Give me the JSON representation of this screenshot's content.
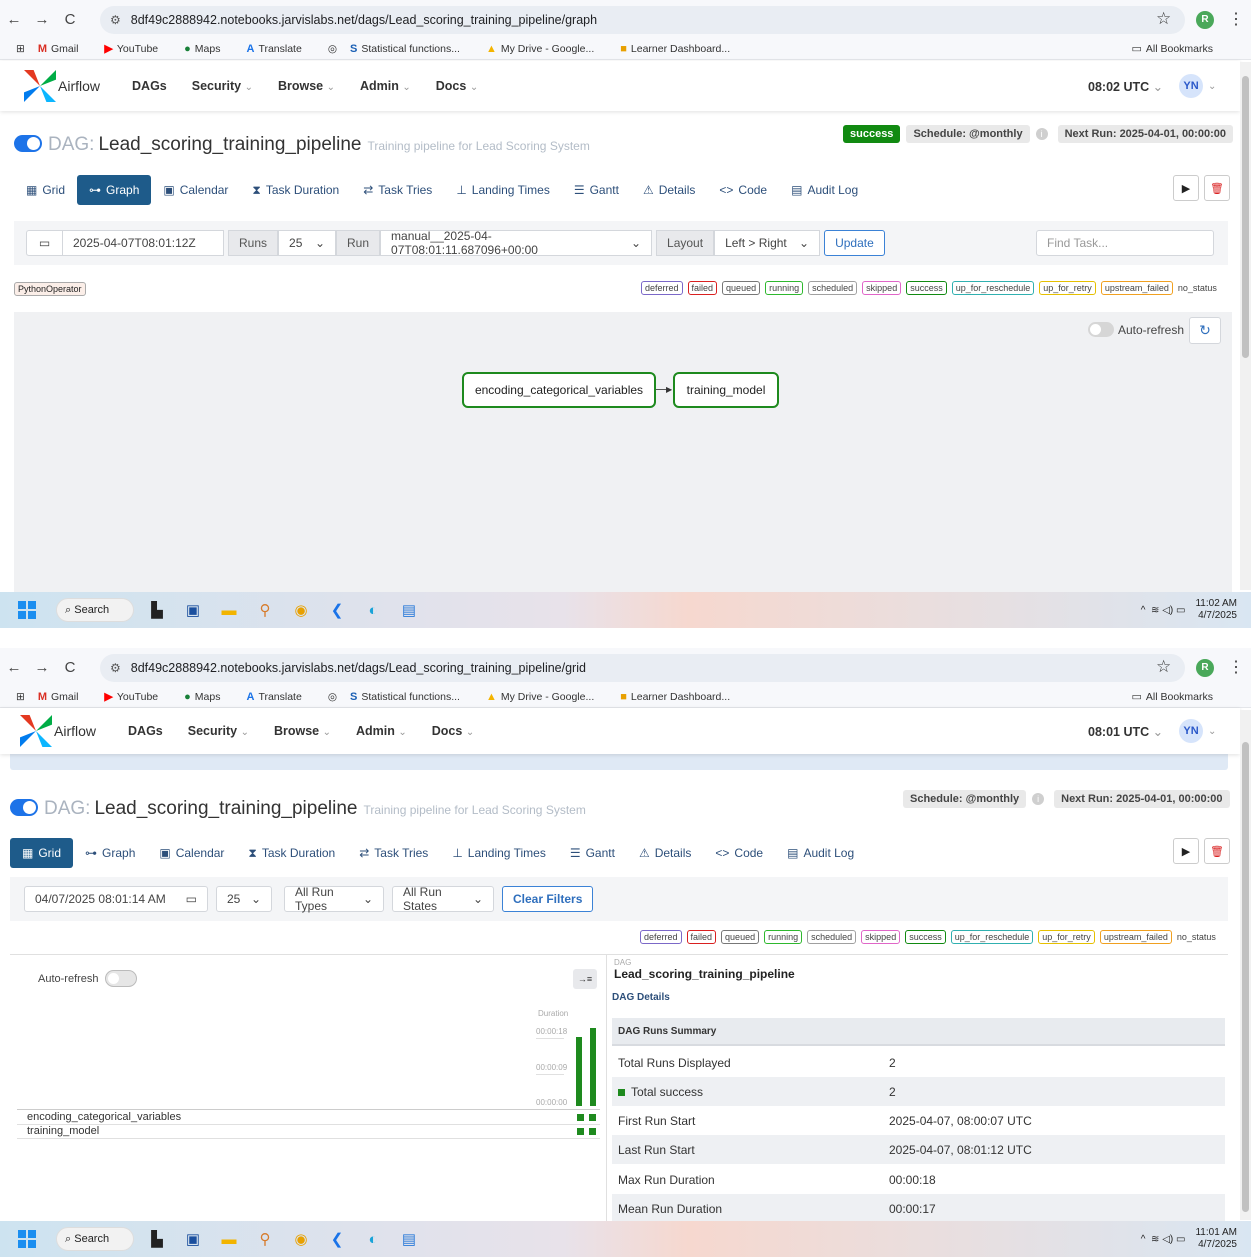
{
  "colors": {
    "success": "#118a11",
    "primary": "#1e5b8a",
    "link": "#2d4f7a",
    "brand_blue": "#1d73e8"
  },
  "shot1": {
    "url": "8df49c2888942.notebooks.jarvislabs.net/dags/Lead_scoring_training_pipeline/graph",
    "utc": "08:02 UTC",
    "run_status": "success",
    "date_value": "2025-04-07T08:01:12Z",
    "runs_label": "Runs",
    "runs_value": "25",
    "run_label": "Run",
    "run_value": "manual__2025-04-07T08:01:11.687096+00:00",
    "layout_label": "Layout",
    "layout_value": "Left > Right",
    "update_label": "Update",
    "find_placeholder": "Find Task...",
    "operator_tag": "PythonOperator",
    "autorefresh": "Auto-refresh",
    "nodes": [
      "encoding_categorical_variables",
      "training_model"
    ],
    "clock_time": "11:02 AM",
    "clock_date": "4/7/2025"
  },
  "shot2": {
    "url": "8df49c2888942.notebooks.jarvislabs.net/dags/Lead_scoring_training_pipeline/grid",
    "utc": "08:01 UTC",
    "date_value": "04/07/2025 08:01:14 AM",
    "runs_value": "25",
    "run_types": "All Run Types",
    "run_states": "All Run States",
    "clear_filters": "Clear Filters",
    "autorefresh": "Auto-refresh",
    "duration_label": "Duration",
    "ticks": [
      "00:00:18",
      "00:00:09",
      "00:00:00"
    ],
    "bar_values_seconds": [
      16,
      18
    ],
    "tasks": [
      "encoding_categorical_variables",
      "training_model"
    ],
    "dag_label": "DAG",
    "dag_name": "Lead_scoring_training_pipeline",
    "details_tab": "DAG Details",
    "summary_header": "DAG Runs Summary",
    "summary": [
      {
        "k": "Total Runs Displayed",
        "v": "2"
      },
      {
        "k": "Total success",
        "v": "2"
      },
      {
        "k": "First Run Start",
        "v": "2025-04-07, 08:00:07 UTC"
      },
      {
        "k": "Last Run Start",
        "v": "2025-04-07, 08:01:12 UTC"
      },
      {
        "k": "Max Run Duration",
        "v": "00:00:18"
      },
      {
        "k": "Mean Run Duration",
        "v": "00:00:17"
      }
    ],
    "clock_time": "11:01 AM",
    "clock_date": "4/7/2025"
  },
  "bookmarks": [
    "Gmail",
    "YouTube",
    "Maps",
    "Translate",
    "Statistical functions...",
    "My Drive - Google...",
    "Learner Dashboard..."
  ],
  "all_bookmarks": "All Bookmarks",
  "nav": {
    "brand": "Airflow",
    "items": [
      "DAGs",
      "Security",
      "Browse",
      "Admin",
      "Docs"
    ],
    "avatar": "YN",
    "profile_initial": "R"
  },
  "dag": {
    "prefix": "DAG:",
    "name": "Lead_scoring_training_pipeline",
    "description": "Training pipeline for Lead Scoring System",
    "schedule": "Schedule: @monthly",
    "next_run": "Next Run: 2025-04-01, 00:00:00"
  },
  "tabs": [
    "Grid",
    "Graph",
    "Calendar",
    "Task Duration",
    "Task Tries",
    "Landing Times",
    "Gantt",
    "Details",
    "Code",
    "Audit Log"
  ],
  "legend": [
    {
      "t": "deferred",
      "c": "#7b68c8"
    },
    {
      "t": "failed",
      "c": "#d92020"
    },
    {
      "t": "queued",
      "c": "#777777"
    },
    {
      "t": "running",
      "c": "#2eb82e"
    },
    {
      "t": "scheduled",
      "c": "#a0a0a0"
    },
    {
      "t": "skipped",
      "c": "#e066c8"
    },
    {
      "t": "success",
      "c": "#118a11"
    },
    {
      "t": "up_for_reschedule",
      "c": "#30b0b0"
    },
    {
      "t": "up_for_retry",
      "c": "#e6c000"
    },
    {
      "t": "upstream_failed",
      "c": "#f0a020"
    }
  ],
  "no_status": "no_status",
  "taskbar": {
    "search": "Search"
  }
}
